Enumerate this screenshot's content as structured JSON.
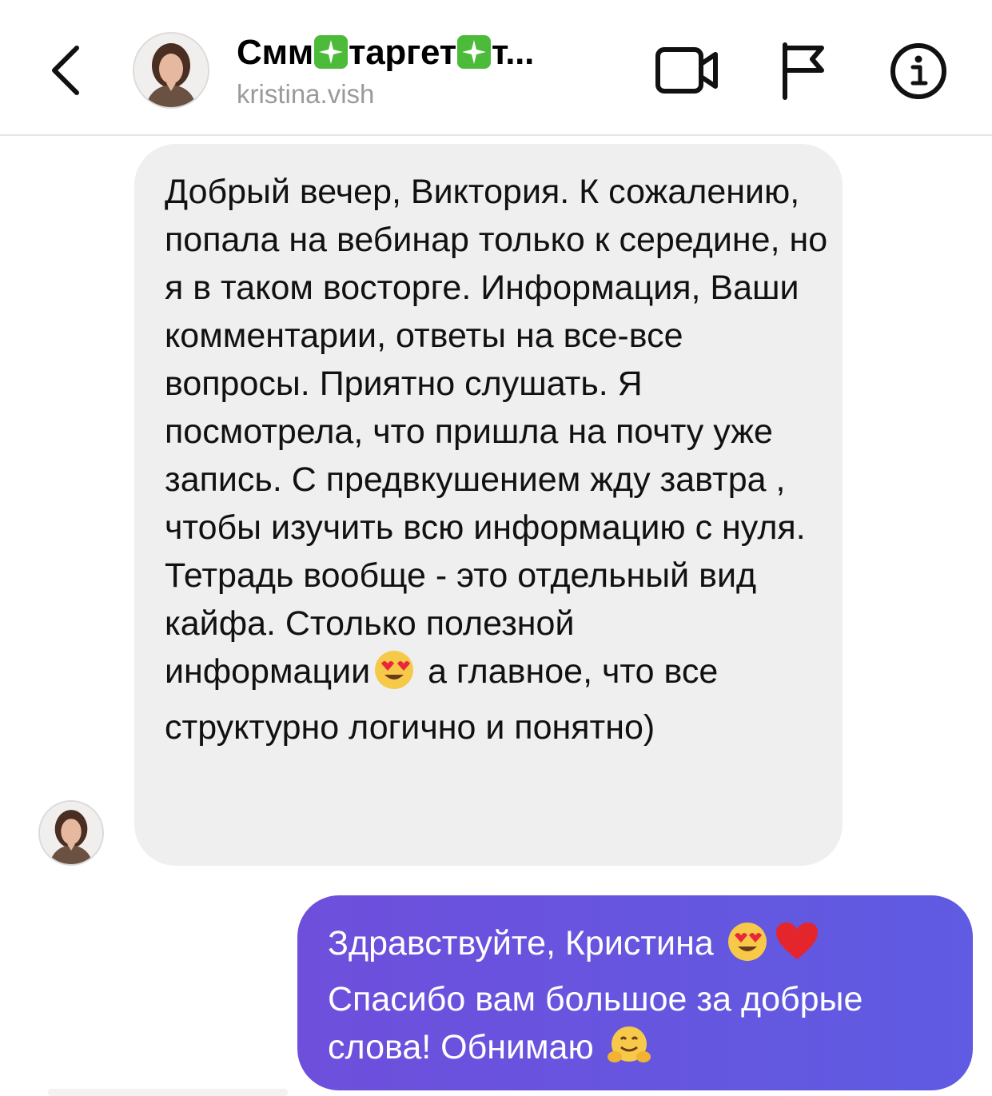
{
  "header": {
    "back_label": "<",
    "title_part1": "Смм",
    "title_part2": "таргет",
    "title_part3": "т...",
    "title_sparkle_icon": "sparkles-emoji-icon",
    "username": "kristina.vish",
    "icons": [
      "back-chevron-icon",
      "video-call-icon",
      "flag-icon",
      "info-icon"
    ]
  },
  "messages": [
    {
      "direction": "incoming",
      "paragraphs": [
        "Добрый вечер, Виктория. К сожалению, попала на вебинар только к середине, но я в таком восторге. Информация, Ваши комментарии, ответы на все-все вопросы. Приятно слушать. Я посмотрела, что пришла на почту уже запись. С предвкушением жду завтра , чтобы изучить всю информацию с нуля.",
        "Тетрадь вообще - это отдельный вид кайфа. Столько полезной"
      ],
      "p2_line3_before": "информации",
      "p2_line3_after": " а главное, что все",
      "p2_line4": "структурно логично и понятно)",
      "emoji": "heart-eyes-emoji-icon"
    },
    {
      "direction": "outgoing",
      "line1": "Здравствуйте, Кристина ",
      "line2": "Спасибо вам большое за добрые",
      "line3": "слова! Обнимаю ",
      "emojis": [
        "heart-eyes-emoji-icon",
        "red-heart-emoji-icon",
        "hugging-face-emoji-icon"
      ]
    }
  ],
  "colors": {
    "incoming_bubble": "#efefef",
    "outgoing_bubble_start": "#6e4fdc",
    "outgoing_bubble_end": "#5f5be2",
    "spark_green": "#4cbb3a",
    "username_gray": "#9a9a9a"
  }
}
